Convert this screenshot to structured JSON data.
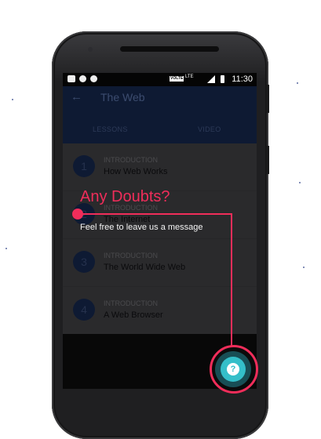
{
  "status_bar": {
    "time": "11:30",
    "network": "LTE",
    "volte": "VOLTE"
  },
  "app_bar": {
    "back_icon": "arrow-left-icon",
    "title": "The Web"
  },
  "tabs": [
    {
      "label": "LESSONS",
      "active": true
    },
    {
      "label": "VIDEO",
      "active": false
    }
  ],
  "lessons": [
    {
      "number": "1",
      "category": "INTRODUCTION",
      "name": "How Web Works"
    },
    {
      "number": "2",
      "category": "INTRODUCTION",
      "name": "The Internet"
    },
    {
      "number": "3",
      "category": "INTRODUCTION",
      "name": "The World Wide Web"
    },
    {
      "number": "4",
      "category": "INTRODUCTION",
      "name": "A Web Browser"
    }
  ],
  "overlay": {
    "heading": "Any Doubts?",
    "message": "Feel free to leave us a message",
    "accent_color": "#f02d5a"
  },
  "fab": {
    "icon": "help-question-icon",
    "glyph": "?",
    "color": "#34bfc9"
  }
}
